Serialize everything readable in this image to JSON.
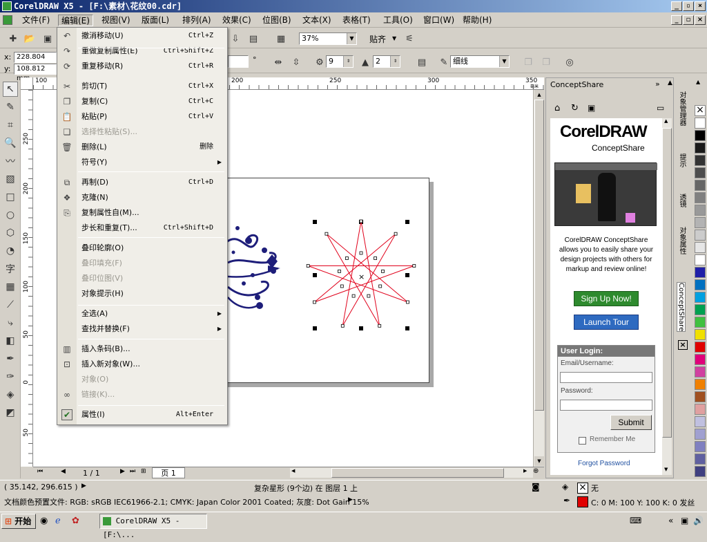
{
  "title": "CorelDRAW X5 - [F:\\素材\\花纹00.cdr]",
  "menu": [
    "文件(F)",
    "编辑(E)",
    "视图(V)",
    "版面(L)",
    "排列(A)",
    "效果(C)",
    "位图(B)",
    "文本(X)",
    "表格(T)",
    "工具(O)",
    "窗口(W)",
    "帮助(H)"
  ],
  "toolbar": {
    "zoom": "37%",
    "snap": "贴齐"
  },
  "propbar": {
    "x": "228.804 mm",
    "y": "108.812 mm",
    "x_label": "x:",
    "y_label": "y:",
    "points": "9",
    "sharpness": "2",
    "outline": "细线",
    "degree": "°"
  },
  "edit_menu": [
    {
      "label": "撤消移动(U)",
      "shortcut": "Ctrl+Z",
      "icon": "undo-icon"
    },
    {
      "label": "重做复制属性(E)",
      "shortcut": "Ctrl+Shift+Z",
      "icon": "redo-icon"
    },
    {
      "label": "重复移动(R)",
      "shortcut": "Ctrl+R",
      "icon": "repeat-icon"
    },
    {
      "label": "剪切(T)",
      "shortcut": "Ctrl+X",
      "icon": "scissors-icon"
    },
    {
      "label": "复制(C)",
      "shortcut": "Ctrl+C",
      "icon": "copy-icon"
    },
    {
      "label": "粘贴(P)",
      "shortcut": "Ctrl+V",
      "icon": "paste-icon"
    },
    {
      "label": "选择性粘贴(S)...",
      "shortcut": "",
      "icon": "paste-special-icon"
    },
    {
      "label": "删除(L)",
      "shortcut": "删除",
      "icon": "trash-icon"
    },
    {
      "label": "符号(Y)",
      "shortcut": "",
      "icon": ""
    },
    {
      "label": "再制(D)",
      "shortcut": "Ctrl+D",
      "icon": "duplicate-icon"
    },
    {
      "label": "克隆(N)",
      "shortcut": "",
      "icon": "clone-icon"
    },
    {
      "label": "复制属性自(M)...",
      "shortcut": "",
      "icon": "copy-properties-icon"
    },
    {
      "label": "步长和重复(T)...",
      "shortcut": "Ctrl+Shift+D",
      "icon": ""
    },
    {
      "label": "叠印轮廓(O)",
      "shortcut": "",
      "icon": ""
    },
    {
      "label": "叠印填充(F)",
      "shortcut": "",
      "icon": ""
    },
    {
      "label": "叠印位图(V)",
      "shortcut": "",
      "icon": ""
    },
    {
      "label": "对象提示(H)",
      "shortcut": "",
      "icon": ""
    },
    {
      "label": "全选(A)",
      "shortcut": "",
      "icon": ""
    },
    {
      "label": "查找并替换(F)",
      "shortcut": "",
      "icon": ""
    },
    {
      "label": "插入条码(B)...",
      "shortcut": "",
      "icon": "barcode-icon"
    },
    {
      "label": "插入新对象(W)...",
      "shortcut": "",
      "icon": "insert-object-icon"
    },
    {
      "label": "对象(O)",
      "shortcut": "",
      "icon": ""
    },
    {
      "label": "链接(K)...",
      "shortcut": "",
      "icon": "link-icon"
    },
    {
      "label": "属性(I)",
      "shortcut": "Alt+Enter",
      "icon": "check-icon"
    }
  ],
  "hruler_ticks": [
    "100",
    "150",
    "200",
    "250",
    "300",
    "350"
  ],
  "vruler_ticks": [
    "250",
    "200",
    "150",
    "100",
    "50",
    "0",
    "50"
  ],
  "ruler_unit": "毫米",
  "docbar": {
    "page_count": "1 / 1",
    "page_tab": "页 1"
  },
  "status": {
    "coords": "( 35.142, 296.615 )",
    "object": "复杂星形 (9个边) 在 图层 1 上",
    "profile": "文档颜色预置文件: RGB: sRGB IEC61966-2.1; CMYK: Japan Color 2001 Coated; 灰度: Dot Gain 15%",
    "fill": "无",
    "outline": "C: 0 M: 100 Y: 100 K: 0  发丝"
  },
  "docker": {
    "title": "ConceptShare",
    "brand": "CorelDRAW",
    "brand_sub": "ConceptShare",
    "desc": "CorelDRAW ConceptShare allows you to easily share your design projects with others for markup and review online!",
    "signup": "Sign Up Now!",
    "launch": "Launch Tour",
    "login_title": "User Login:",
    "email_label": "Email/Username:",
    "password_label": "Password:",
    "submit": "Submit",
    "remember": "Remember Me",
    "forgot": "Forgot Password"
  },
  "docker_tabs": [
    "对象管理器",
    "提示",
    "透镜",
    "对象属性",
    "ConceptShare"
  ],
  "palette": [
    "#ffffff",
    "#000000",
    "#1a1a1a",
    "#333333",
    "#4d4d4d",
    "#666666",
    "#808080",
    "#999999",
    "#b3b3b3",
    "#cccccc",
    "#e6e6e6",
    "#ffffff",
    "#1f1fa8",
    "#0070c0",
    "#00a0e0",
    "#00a050",
    "#40c040",
    "#f0e000",
    "#e00000",
    "#e0007a",
    "#d040a0",
    "#f08000",
    "#a05020",
    "#e0a0a0",
    "#c0c0e0",
    "#a0a0d0",
    "#8080c0",
    "#6060a0",
    "#404080"
  ],
  "taskbar": {
    "start": "开始",
    "app": "CorelDRAW X5 - [F:\\..."
  },
  "colors": {
    "star": "#e0001a",
    "ornament": "#1e1e7a",
    "title_start": "#0a246a",
    "signup": "#2e8a2e",
    "launch": "#2e6ac0"
  }
}
